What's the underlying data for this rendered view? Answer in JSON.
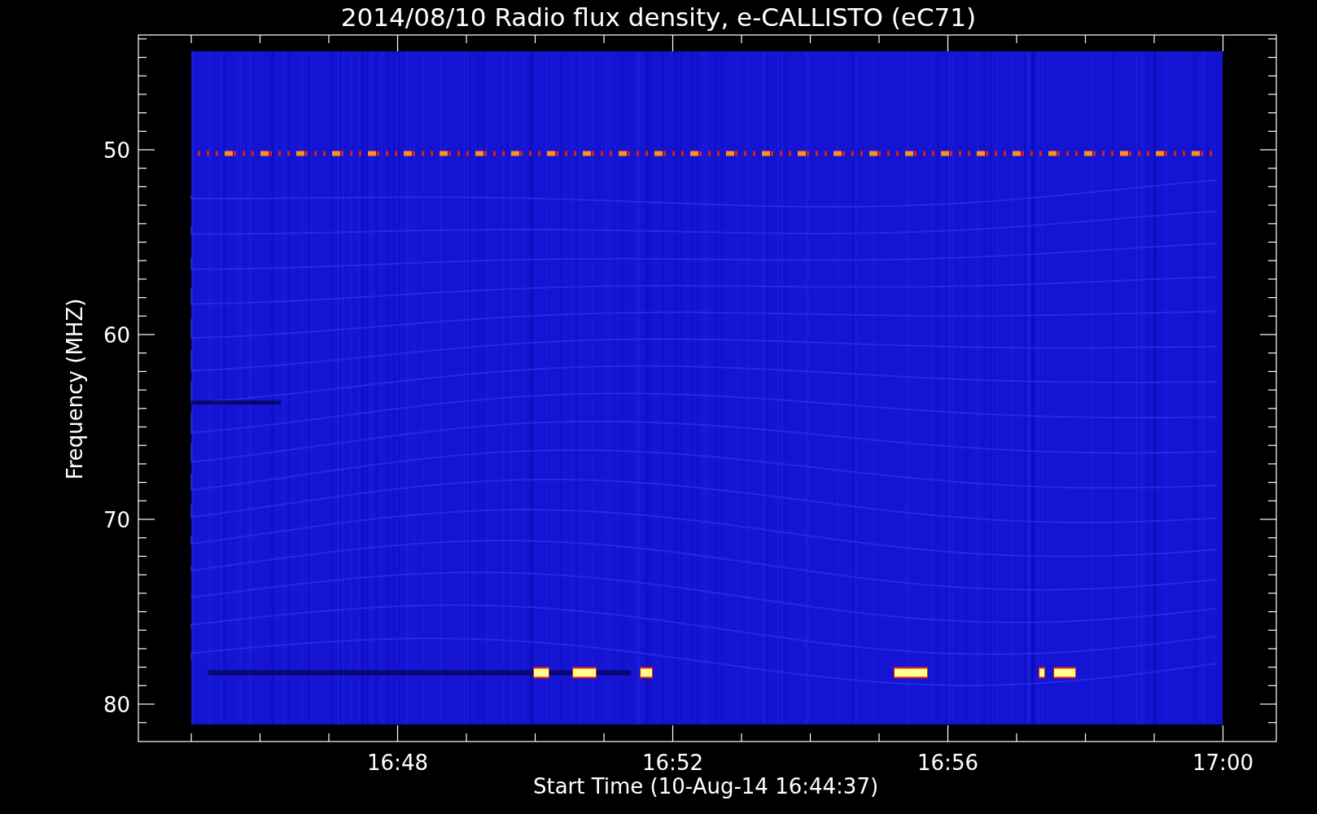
{
  "title": "2014/08/10  Radio flux density, e-CALLISTO (eC71)",
  "y_axis": {
    "label": "Frequency (MHZ)",
    "ticks": [
      "50",
      "60",
      "70",
      "80"
    ]
  },
  "x_axis": {
    "label": "Start Time (10-Aug-14 16:44:37)",
    "ticks": [
      "16:48",
      "16:52",
      "16:56",
      "17:00"
    ]
  }
}
